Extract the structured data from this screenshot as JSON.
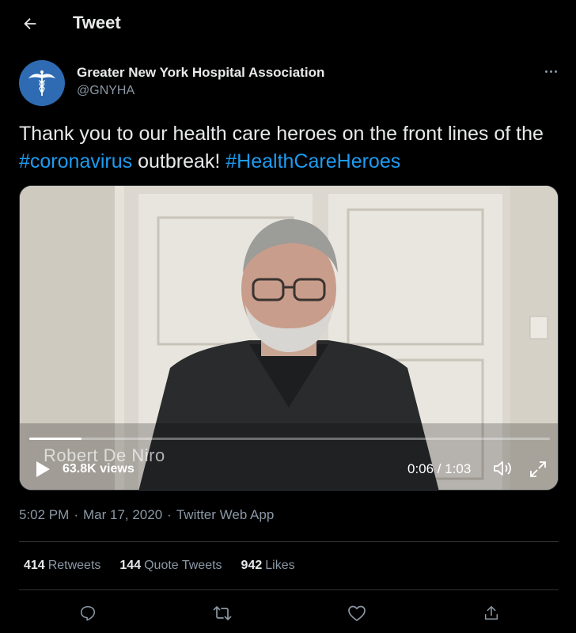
{
  "header": {
    "title": "Tweet"
  },
  "author": {
    "name": "Greater New York Hospital Association",
    "handle": "@GNYHA",
    "avatar_color": "#2f6bb3"
  },
  "tweet": {
    "text_part1": "Thank you to our health care heroes on the front lines of the ",
    "hashtag1": "#coronavirus",
    "text_part2": " outbreak! ",
    "hashtag2": "#HealthCareHeroes"
  },
  "video": {
    "overlay_caption": "Robert De Niro",
    "views": "63.8K views",
    "time": "0:06 / 1:03",
    "progress_fraction": 0.1
  },
  "meta": {
    "time": "5:02 PM",
    "date": "Mar 17, 2020",
    "source": "Twitter Web App",
    "separator": "·"
  },
  "stats": {
    "retweets_count": "414",
    "retweets_label": "Retweets",
    "quotes_count": "144",
    "quotes_label": "Quote Tweets",
    "likes_count": "942",
    "likes_label": "Likes"
  },
  "colors": {
    "accent": "#1d9bf0",
    "background": "#000000",
    "secondary_text": "#8b98a5"
  },
  "icons": [
    "back-arrow-icon",
    "more-icon",
    "caduceus-icon",
    "play-icon",
    "volume-icon",
    "fullscreen-icon",
    "reply-icon",
    "retweet-icon",
    "like-icon",
    "share-icon"
  ]
}
